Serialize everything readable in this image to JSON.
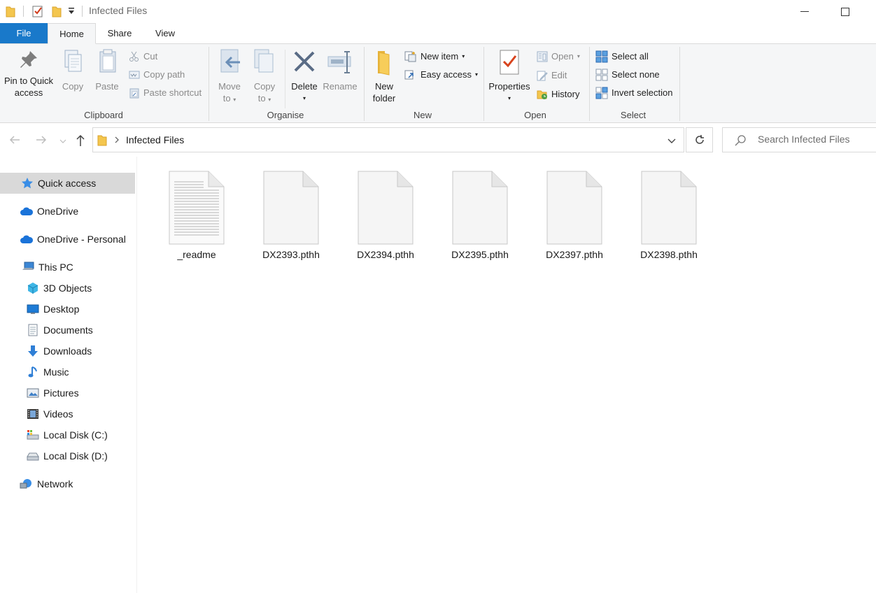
{
  "window": {
    "title": "Infected Files",
    "minimize_glyph": "—",
    "maximize_glyph": "☐"
  },
  "tabs": [
    {
      "label": "File"
    },
    {
      "label": "Home"
    },
    {
      "label": "Share"
    },
    {
      "label": "View"
    }
  ],
  "ribbon": {
    "clipboard": {
      "group_label": "Clipboard",
      "pin_line1": "Pin to Quick",
      "pin_line2": "access",
      "copy": "Copy",
      "paste": "Paste",
      "cut": "Cut",
      "copy_path": "Copy path",
      "paste_shortcut": "Paste shortcut"
    },
    "organise": {
      "group_label": "Organise",
      "move_line1": "Move",
      "move_line2": "to",
      "copy_line1": "Copy",
      "copy_line2": "to",
      "delete": "Delete",
      "rename": "Rename"
    },
    "new": {
      "group_label": "New",
      "new_folder_line1": "New",
      "new_folder_line2": "folder",
      "new_item": "New item",
      "easy_access": "Easy access"
    },
    "open": {
      "group_label": "Open",
      "properties": "Properties",
      "open": "Open",
      "edit": "Edit",
      "history": "History"
    },
    "select": {
      "group_label": "Select",
      "select_all": "Select all",
      "select_none": "Select none",
      "invert_selection": "Invert selection"
    }
  },
  "address": {
    "breadcrumb": "Infected Files",
    "search_placeholder": "Search Infected Files"
  },
  "nav": {
    "quick_access": "Quick access",
    "onedrive": "OneDrive",
    "onedrive_personal": "OneDrive - Personal",
    "this_pc": "This PC",
    "objects_3d": "3D Objects",
    "desktop": "Desktop",
    "documents": "Documents",
    "downloads": "Downloads",
    "music": "Music",
    "pictures": "Pictures",
    "videos": "Videos",
    "local_c": "Local Disk (C:)",
    "local_d": "Local Disk (D:)",
    "network": "Network"
  },
  "files": [
    {
      "name": "_readme",
      "icon": "text-document-icon"
    },
    {
      "name": "DX2393.pthh",
      "icon": "blank-file-icon"
    },
    {
      "name": "DX2394.pthh",
      "icon": "blank-file-icon"
    },
    {
      "name": "DX2395.pthh",
      "icon": "blank-file-icon"
    },
    {
      "name": "DX2397.pthh",
      "icon": "blank-file-icon"
    },
    {
      "name": "DX2398.pthh",
      "icon": "blank-file-icon"
    }
  ],
  "colors": {
    "file_tab": "#1979ca",
    "ribbon_bg": "#f5f6f7",
    "selected_nav": "#d9d9d9",
    "folder_yellow": "#f4c64e"
  }
}
